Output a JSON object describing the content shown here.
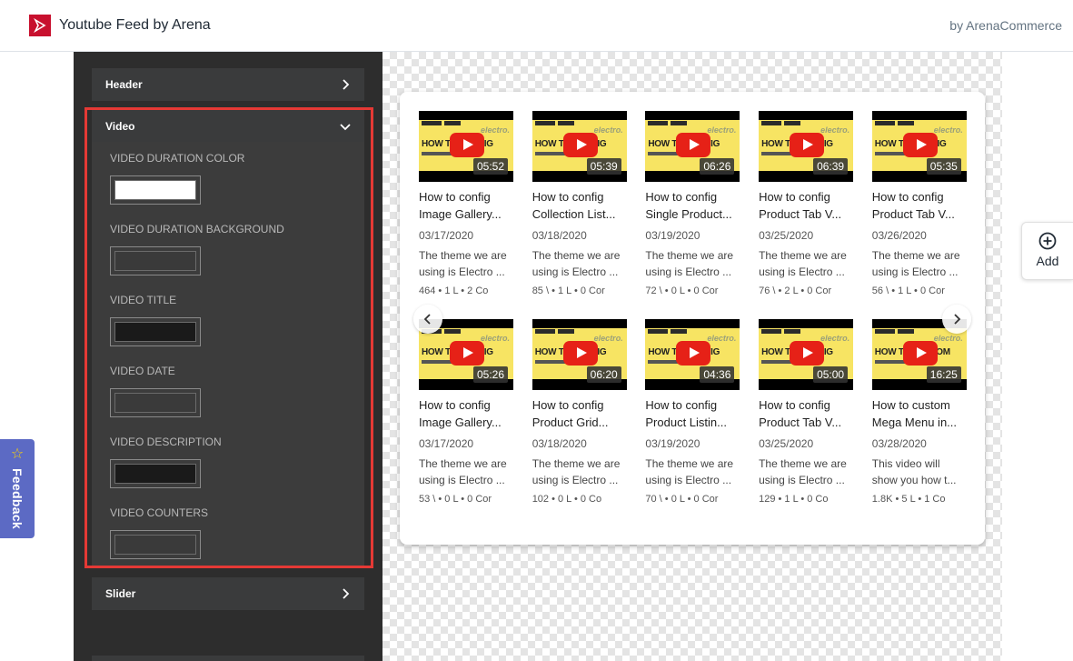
{
  "app": {
    "title": "Youtube Feed by Arena",
    "by": "by ArenaCommerce"
  },
  "feedback": {
    "label": "Feedback"
  },
  "add": {
    "label": "Add"
  },
  "panel": {
    "header_section": "Header",
    "video_section": "Video",
    "slider_section": "Slider",
    "fields": [
      {
        "label": "VIDEO DURATION COLOR",
        "color": "#ffffff"
      },
      {
        "label": "VIDEO DURATION BACKGROUND",
        "color": "#3a3a3a"
      },
      {
        "label": "VIDEO TITLE",
        "color": "#1a1a1a"
      },
      {
        "label": "VIDEO DATE",
        "color": "#3a3a3a"
      },
      {
        "label": "VIDEO DESCRIPTION",
        "color": "#1a1a1a"
      },
      {
        "label": "VIDEO COUNTERS",
        "color": "#3a3a3a"
      }
    ]
  },
  "thumb": {
    "brand": "electro.",
    "how": "HOW TO CONFIG",
    "how_custom": "HOW TO CUSTOM"
  },
  "videos": [
    {
      "duration": "05:52",
      "title1": "How to config",
      "title2": "Image Gallery...",
      "date": "03/17/2020",
      "desc1": "The theme we are",
      "desc2": "using is Electro ...",
      "counters": "464  •  1 L  •  2 Co"
    },
    {
      "duration": "05:39",
      "title1": "How to config",
      "title2": "Collection List...",
      "date": "03/18/2020",
      "desc1": "The theme we are",
      "desc2": "using is Electro ...",
      "counters": "85 \\  •  1 L  •  0 Cor"
    },
    {
      "duration": "06:26",
      "title1": "How to config",
      "title2": "Single Product...",
      "date": "03/19/2020",
      "desc1": "The theme we are",
      "desc2": "using is Electro ...",
      "counters": "72 \\  •  0 L  •  0 Cor"
    },
    {
      "duration": "06:39",
      "title1": "How to config",
      "title2": "Product Tab V...",
      "date": "03/25/2020",
      "desc1": "The theme we are",
      "desc2": "using is Electro ...",
      "counters": "76 \\  •  2 L  •  0 Cor"
    },
    {
      "duration": "05:35",
      "title1": "How to config",
      "title2": "Product Tab V...",
      "date": "03/26/2020",
      "desc1": "The theme we are",
      "desc2": "using is Electro ...",
      "counters": "56 \\  •  1 L  •  0 Cor"
    },
    {
      "duration": "05:26",
      "title1": "How to config",
      "title2": "Image Gallery...",
      "date": "03/17/2020",
      "desc1": "The theme we are",
      "desc2": "using is Electro ...",
      "counters": "53 \\  •  0 L  •  0 Cor"
    },
    {
      "duration": "06:20",
      "title1": "How to config",
      "title2": "Product Grid...",
      "date": "03/18/2020",
      "desc1": "The theme we are",
      "desc2": "using is Electro ...",
      "counters": "102  •  0 L  •  0 Co"
    },
    {
      "duration": "04:36",
      "title1": "How to config",
      "title2": "Product Listin...",
      "date": "03/19/2020",
      "desc1": "The theme we are",
      "desc2": "using is Electro ...",
      "counters": "70 \\  •  0 L  •  0 Cor"
    },
    {
      "duration": "05:00",
      "title1": "How to config",
      "title2": "Product Tab V...",
      "date": "03/25/2020",
      "desc1": "The theme we are",
      "desc2": "using is Electro ...",
      "counters": "129  •  1 L  •  0 Co"
    },
    {
      "duration": "16:25",
      "title1": "How to custom",
      "title2": "Mega Menu in...",
      "date": "03/28/2020",
      "desc1": "This video will",
      "desc2": "show you how t...",
      "counters": "1.8K  •  5 L  •  1 Co"
    }
  ]
}
